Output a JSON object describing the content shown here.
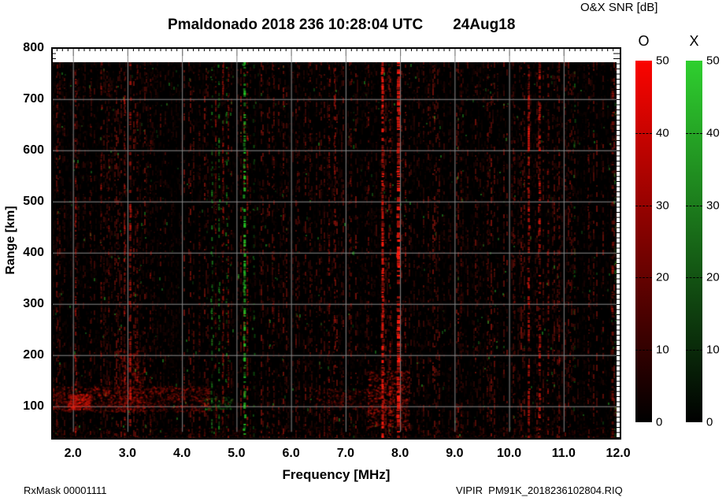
{
  "chart_data": {
    "type": "heatmap",
    "title": "Pmaldonado 2018 236 10:28:04 UTC",
    "date_label": "24Aug18",
    "colorbar_title": "O&X SNR [dB]",
    "xlabel": "Frequency [MHz]",
    "ylabel": "Range [km]",
    "footer_left": "RxMask 00001111",
    "footer_right": "VIPIR  PM91K_2018236102804.RIQ",
    "xlim": [
      1.6,
      11.97
    ],
    "ylim_km": [
      35,
      772
    ],
    "grid": true,
    "grid_color": "#8a8a8a",
    "background_color": "#000000",
    "x_ticks": [
      2.0,
      3.0,
      4.0,
      5.0,
      6.0,
      7.0,
      8.0,
      9.0,
      10.0,
      11.0,
      12.0
    ],
    "x_tick_labels": [
      "2.0",
      "3.0",
      "4.0",
      "5.0",
      "6.0",
      "7.0",
      "8.0",
      "9.0",
      "10.0",
      "11.0",
      "12.0"
    ],
    "y_ticks": [
      800,
      700,
      600,
      500,
      400,
      300,
      200,
      100
    ],
    "y_tick_labels": [
      "800",
      "700",
      "600",
      "500",
      "400",
      "300",
      "200",
      "100"
    ],
    "minor_tick_mhz": 0.1,
    "minor_tick_km": 10,
    "colorbars": [
      {
        "label": "O",
        "pol": "O",
        "top_color": "#fb0400",
        "bottom_color": "#000000",
        "ticks": [
          0,
          10,
          20,
          30,
          40,
          50
        ]
      },
      {
        "label": "X",
        "pol": "X",
        "top_color": "#2fcf2f",
        "bottom_color": "#000000",
        "ticks": [
          0,
          10,
          20,
          30,
          40,
          50
        ]
      }
    ],
    "snr_range_db": [
      0,
      50
    ],
    "noise": {
      "seed": 1337,
      "column_step": 2,
      "fill_prob": 0.52,
      "green_specks": 380
    },
    "features": [
      {
        "mhz": 1.72,
        "pol": "O",
        "density": 0.35,
        "strength": 0.35,
        "width": 2
      },
      {
        "mhz": 2.05,
        "pol": "O",
        "density": 0.5,
        "strength": 0.5,
        "width": 2
      },
      {
        "mhz": 2.32,
        "pol": "O",
        "density": 0.3,
        "strength": 0.3,
        "width": 2
      },
      {
        "mhz": 2.52,
        "pol": "O",
        "density": 0.35,
        "strength": 0.38,
        "width": 2
      },
      {
        "mhz": 2.66,
        "pol": "O",
        "density": 0.3,
        "strength": 0.35,
        "width": 2
      },
      {
        "mhz": 2.95,
        "pol": "O",
        "density": 0.45,
        "strength": 0.5,
        "width": 2
      },
      {
        "mhz": 3.05,
        "pol": "O",
        "density": 0.5,
        "strength": 0.55,
        "width": 3
      },
      {
        "mhz": 3.18,
        "pol": "O",
        "density": 0.35,
        "strength": 0.4,
        "width": 2
      },
      {
        "mhz": 3.42,
        "pol": "O",
        "density": 0.25,
        "strength": 0.3,
        "width": 2
      },
      {
        "mhz": 4.32,
        "pol": "O",
        "density": 0.25,
        "strength": 0.3,
        "width": 2
      },
      {
        "mhz": 4.62,
        "pol": "O",
        "density": 0.3,
        "strength": 0.35,
        "width": 2
      },
      {
        "mhz": 4.75,
        "pol": "O",
        "density": 0.4,
        "strength": 0.45,
        "width": 2
      },
      {
        "mhz": 4.85,
        "pol": "O",
        "density": 0.35,
        "strength": 0.4,
        "width": 2
      },
      {
        "mhz": 5.2,
        "pol": "O",
        "density": 0.4,
        "strength": 0.5,
        "width": 2
      },
      {
        "mhz": 5.68,
        "pol": "O",
        "density": 0.25,
        "strength": 0.3,
        "width": 2
      },
      {
        "mhz": 6.12,
        "pol": "O",
        "density": 0.2,
        "strength": 0.28,
        "width": 2
      },
      {
        "mhz": 6.7,
        "pol": "O",
        "density": 0.4,
        "strength": 0.45,
        "width": 2
      },
      {
        "mhz": 6.8,
        "pol": "O",
        "density": 0.3,
        "strength": 0.38,
        "width": 2
      },
      {
        "mhz": 7.1,
        "pol": "O",
        "density": 0.3,
        "strength": 0.33,
        "width": 2
      },
      {
        "mhz": 7.42,
        "pol": "O",
        "density": 0.3,
        "strength": 0.35,
        "width": 2
      },
      {
        "mhz": 7.68,
        "pol": "O",
        "density": 0.8,
        "strength": 0.95,
        "width": 3
      },
      {
        "mhz": 7.82,
        "pol": "O",
        "density": 0.45,
        "strength": 0.5,
        "width": 2
      },
      {
        "mhz": 7.97,
        "pol": "O",
        "density": 0.75,
        "strength": 0.95,
        "width": 4
      },
      {
        "mhz": 8.1,
        "pol": "O",
        "density": 0.4,
        "strength": 0.45,
        "width": 2
      },
      {
        "mhz": 8.55,
        "pol": "O",
        "density": 0.2,
        "strength": 0.25,
        "width": 2
      },
      {
        "mhz": 9.12,
        "pol": "O",
        "density": 0.25,
        "strength": 0.3,
        "width": 2
      },
      {
        "mhz": 9.6,
        "pol": "O",
        "density": 0.25,
        "strength": 0.3,
        "width": 2
      },
      {
        "mhz": 10.1,
        "pol": "O",
        "density": 0.3,
        "strength": 0.35,
        "width": 2
      },
      {
        "mhz": 10.36,
        "pol": "O",
        "density": 0.55,
        "strength": 0.6,
        "width": 3
      },
      {
        "mhz": 10.56,
        "pol": "O",
        "density": 0.55,
        "strength": 0.65,
        "width": 3
      },
      {
        "mhz": 10.72,
        "pol": "O",
        "density": 0.4,
        "strength": 0.45,
        "width": 2
      },
      {
        "mhz": 10.92,
        "pol": "O",
        "density": 0.3,
        "strength": 0.38,
        "width": 2
      },
      {
        "mhz": 11.12,
        "pol": "O",
        "density": 0.3,
        "strength": 0.35,
        "width": 2
      },
      {
        "mhz": 11.45,
        "pol": "O",
        "density": 0.25,
        "strength": 0.3,
        "width": 2
      },
      {
        "mhz": 11.9,
        "pol": "O",
        "density": 0.35,
        "strength": 0.4,
        "width": 3
      },
      {
        "mhz": 4.55,
        "pol": "X",
        "density": 0.3,
        "strength": 0.5,
        "width": 2
      },
      {
        "mhz": 4.68,
        "pol": "X",
        "density": 0.35,
        "strength": 0.55,
        "width": 2
      },
      {
        "mhz": 4.82,
        "pol": "X",
        "density": 0.25,
        "strength": 0.45,
        "width": 2
      },
      {
        "mhz": 5.15,
        "pol": "X",
        "density": 0.55,
        "strength": 0.85,
        "width": 3
      },
      {
        "mhz": 5.32,
        "pol": "X",
        "density": 0.2,
        "strength": 0.35,
        "width": 2
      },
      {
        "mhz": 7.15,
        "pol": "X",
        "density": 0.12,
        "strength": 0.35,
        "width": 2
      },
      {
        "mhz": 11.2,
        "pol": "X",
        "density": 0.12,
        "strength": 0.35,
        "width": 2
      },
      {
        "mhz": 11.95,
        "pol": "X",
        "density": 0.15,
        "strength": 0.4,
        "width": 2
      }
    ],
    "blobs": [
      {
        "mhz": [
          1.6,
          4.5
        ],
        "km": [
          90,
          140
        ],
        "pol": "O",
        "strength": 0.55,
        "count": 1200
      },
      {
        "mhz": [
          1.9,
          2.3
        ],
        "km": [
          95,
          125
        ],
        "pol": "O",
        "strength": 0.9,
        "count": 260
      },
      {
        "mhz": [
          2.8,
          3.3
        ],
        "km": [
          90,
          210
        ],
        "pol": "O",
        "strength": 0.6,
        "count": 320
      },
      {
        "mhz": [
          7.4,
          8.15
        ],
        "km": [
          60,
          170
        ],
        "pol": "O",
        "strength": 0.8,
        "count": 520
      },
      {
        "mhz": [
          6.4,
          7.6
        ],
        "km": [
          95,
          135
        ],
        "pol": "O",
        "strength": 0.4,
        "count": 260
      },
      {
        "mhz": [
          4.4,
          4.9
        ],
        "km": [
          95,
          120
        ],
        "pol": "X",
        "strength": 0.55,
        "count": 70
      },
      {
        "mhz": [
          1.6,
          11.9
        ],
        "km": [
          35,
          60
        ],
        "pol": "O",
        "strength": 0.25,
        "count": 700
      }
    ]
  }
}
